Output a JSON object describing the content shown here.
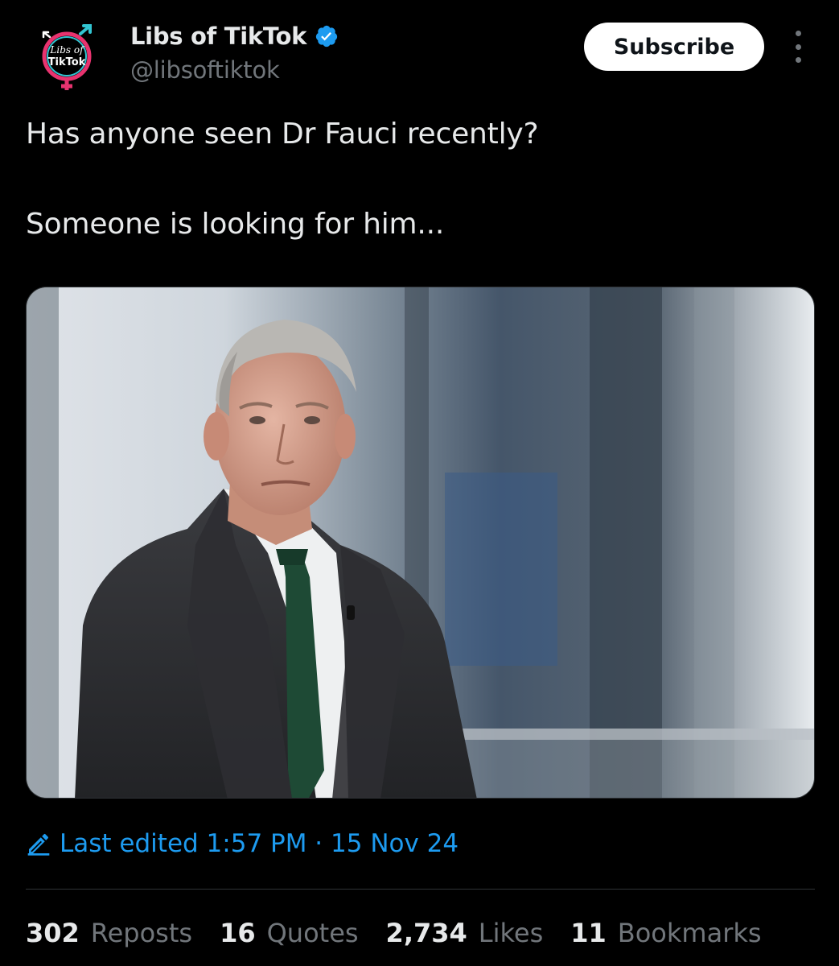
{
  "account": {
    "display_name": "Libs of TikTok",
    "handle": "@libsoftiktok",
    "avatar_text_top": "Libs of",
    "avatar_text_bottom": "TikTok",
    "verified": true
  },
  "header": {
    "subscribe_label": "Subscribe",
    "more_icon": "more-vertical-icon"
  },
  "tweet": {
    "line1": "Has anyone seen Dr Fauci recently?",
    "line2": "Someone is looking for him...",
    "media_description_icon": "photo-icon"
  },
  "edited": {
    "icon": "pencil-icon",
    "label": "Last edited 1:57 PM · 15 Nov 24"
  },
  "stats": [
    {
      "count": "302",
      "label": "Reposts"
    },
    {
      "count": "16",
      "label": "Quotes"
    },
    {
      "count": "2,734",
      "label": "Likes"
    },
    {
      "count": "11",
      "label": "Bookmarks"
    }
  ],
  "colors": {
    "background": "#000000",
    "text_primary": "#e7e9ea",
    "text_secondary": "#71767b",
    "accent_blue": "#1d9bf0",
    "divider": "#2f3336",
    "avatar_pink": "#e8336f",
    "avatar_teal": "#32c5d2"
  }
}
